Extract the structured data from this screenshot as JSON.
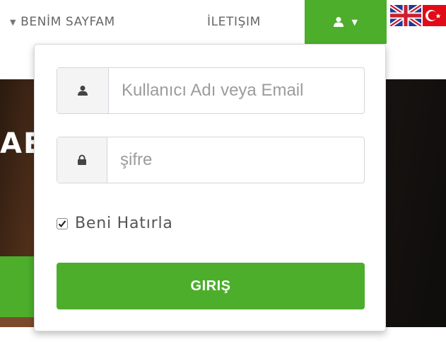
{
  "nav": {
    "benim_sayfam": "BENİM SAYFAM",
    "iletisim": "İLETIŞIM",
    "user_menu_icon": "user-icon",
    "caret_icon": "caret-down-icon"
  },
  "languages": [
    {
      "name": "flag-uk-icon"
    },
    {
      "name": "flag-tr-icon"
    }
  ],
  "login": {
    "username_placeholder": "Kullanıcı Adı veya Email",
    "password_placeholder": "şifre",
    "remember_label": "Beni Hatırla",
    "remember_checked": true,
    "submit_label": "GIRIŞ"
  },
  "hero": {
    "partial_text": "AE"
  },
  "colors": {
    "accent": "#4cae2b",
    "addon_bg": "#f4f4f4",
    "border": "#d2d6dc"
  }
}
